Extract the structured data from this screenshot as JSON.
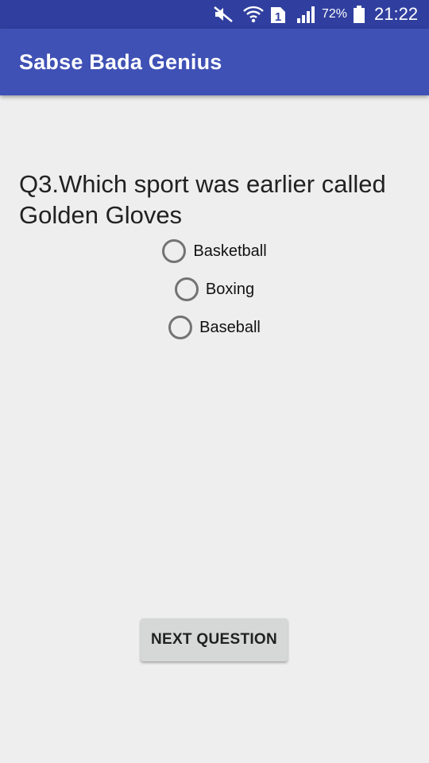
{
  "status_bar": {
    "battery_percent": "72%",
    "time": "21:22",
    "sim_badge": "1",
    "icons": [
      "mute-icon",
      "wifi-icon",
      "sim-1-icon",
      "signal-icon",
      "battery-icon"
    ]
  },
  "app_bar": {
    "title": "Sabse Bada Genius",
    "color": "#3f51b5",
    "status_color": "#303f9f"
  },
  "question": {
    "text": "Q3.Which sport was earlier called Golden Gloves"
  },
  "options": [
    {
      "label": "Basketball",
      "selected": false
    },
    {
      "label": "Boxing",
      "selected": false
    },
    {
      "label": "Baseball",
      "selected": false
    }
  ],
  "next_button": {
    "label": "NEXT QUESTION"
  }
}
